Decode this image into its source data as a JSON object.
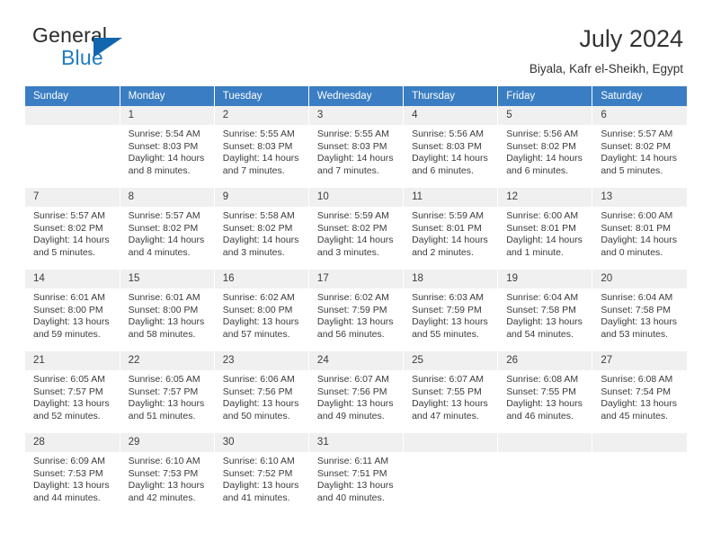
{
  "brand": {
    "line1": "General",
    "line2": "Blue",
    "triangle_color": "#1266ad",
    "blue_color": "#1f7cc4"
  },
  "header": {
    "title": "July 2024",
    "subtitle": "Biyala, Kafr el-Sheikh, Egypt"
  },
  "theme": {
    "header_bar": "#3a7dc2",
    "daynum_bg": "#f0f0f0",
    "text": "#3b3b3b"
  },
  "calendar": {
    "weekday_headers": [
      "Sunday",
      "Monday",
      "Tuesday",
      "Wednesday",
      "Thursday",
      "Friday",
      "Saturday"
    ],
    "weeks": [
      [
        {
          "day": "",
          "sunrise": "",
          "sunset": "",
          "daylight1": "",
          "daylight2": ""
        },
        {
          "day": "1",
          "sunrise": "Sunrise: 5:54 AM",
          "sunset": "Sunset: 8:03 PM",
          "daylight1": "Daylight: 14 hours",
          "daylight2": "and 8 minutes."
        },
        {
          "day": "2",
          "sunrise": "Sunrise: 5:55 AM",
          "sunset": "Sunset: 8:03 PM",
          "daylight1": "Daylight: 14 hours",
          "daylight2": "and 7 minutes."
        },
        {
          "day": "3",
          "sunrise": "Sunrise: 5:55 AM",
          "sunset": "Sunset: 8:03 PM",
          "daylight1": "Daylight: 14 hours",
          "daylight2": "and 7 minutes."
        },
        {
          "day": "4",
          "sunrise": "Sunrise: 5:56 AM",
          "sunset": "Sunset: 8:03 PM",
          "daylight1": "Daylight: 14 hours",
          "daylight2": "and 6 minutes."
        },
        {
          "day": "5",
          "sunrise": "Sunrise: 5:56 AM",
          "sunset": "Sunset: 8:02 PM",
          "daylight1": "Daylight: 14 hours",
          "daylight2": "and 6 minutes."
        },
        {
          "day": "6",
          "sunrise": "Sunrise: 5:57 AM",
          "sunset": "Sunset: 8:02 PM",
          "daylight1": "Daylight: 14 hours",
          "daylight2": "and 5 minutes."
        }
      ],
      [
        {
          "day": "7",
          "sunrise": "Sunrise: 5:57 AM",
          "sunset": "Sunset: 8:02 PM",
          "daylight1": "Daylight: 14 hours",
          "daylight2": "and 5 minutes."
        },
        {
          "day": "8",
          "sunrise": "Sunrise: 5:57 AM",
          "sunset": "Sunset: 8:02 PM",
          "daylight1": "Daylight: 14 hours",
          "daylight2": "and 4 minutes."
        },
        {
          "day": "9",
          "sunrise": "Sunrise: 5:58 AM",
          "sunset": "Sunset: 8:02 PM",
          "daylight1": "Daylight: 14 hours",
          "daylight2": "and 3 minutes."
        },
        {
          "day": "10",
          "sunrise": "Sunrise: 5:59 AM",
          "sunset": "Sunset: 8:02 PM",
          "daylight1": "Daylight: 14 hours",
          "daylight2": "and 3 minutes."
        },
        {
          "day": "11",
          "sunrise": "Sunrise: 5:59 AM",
          "sunset": "Sunset: 8:01 PM",
          "daylight1": "Daylight: 14 hours",
          "daylight2": "and 2 minutes."
        },
        {
          "day": "12",
          "sunrise": "Sunrise: 6:00 AM",
          "sunset": "Sunset: 8:01 PM",
          "daylight1": "Daylight: 14 hours",
          "daylight2": "and 1 minute."
        },
        {
          "day": "13",
          "sunrise": "Sunrise: 6:00 AM",
          "sunset": "Sunset: 8:01 PM",
          "daylight1": "Daylight: 14 hours",
          "daylight2": "and 0 minutes."
        }
      ],
      [
        {
          "day": "14",
          "sunrise": "Sunrise: 6:01 AM",
          "sunset": "Sunset: 8:00 PM",
          "daylight1": "Daylight: 13 hours",
          "daylight2": "and 59 minutes."
        },
        {
          "day": "15",
          "sunrise": "Sunrise: 6:01 AM",
          "sunset": "Sunset: 8:00 PM",
          "daylight1": "Daylight: 13 hours",
          "daylight2": "and 58 minutes."
        },
        {
          "day": "16",
          "sunrise": "Sunrise: 6:02 AM",
          "sunset": "Sunset: 8:00 PM",
          "daylight1": "Daylight: 13 hours",
          "daylight2": "and 57 minutes."
        },
        {
          "day": "17",
          "sunrise": "Sunrise: 6:02 AM",
          "sunset": "Sunset: 7:59 PM",
          "daylight1": "Daylight: 13 hours",
          "daylight2": "and 56 minutes."
        },
        {
          "day": "18",
          "sunrise": "Sunrise: 6:03 AM",
          "sunset": "Sunset: 7:59 PM",
          "daylight1": "Daylight: 13 hours",
          "daylight2": "and 55 minutes."
        },
        {
          "day": "19",
          "sunrise": "Sunrise: 6:04 AM",
          "sunset": "Sunset: 7:58 PM",
          "daylight1": "Daylight: 13 hours",
          "daylight2": "and 54 minutes."
        },
        {
          "day": "20",
          "sunrise": "Sunrise: 6:04 AM",
          "sunset": "Sunset: 7:58 PM",
          "daylight1": "Daylight: 13 hours",
          "daylight2": "and 53 minutes."
        }
      ],
      [
        {
          "day": "21",
          "sunrise": "Sunrise: 6:05 AM",
          "sunset": "Sunset: 7:57 PM",
          "daylight1": "Daylight: 13 hours",
          "daylight2": "and 52 minutes."
        },
        {
          "day": "22",
          "sunrise": "Sunrise: 6:05 AM",
          "sunset": "Sunset: 7:57 PM",
          "daylight1": "Daylight: 13 hours",
          "daylight2": "and 51 minutes."
        },
        {
          "day": "23",
          "sunrise": "Sunrise: 6:06 AM",
          "sunset": "Sunset: 7:56 PM",
          "daylight1": "Daylight: 13 hours",
          "daylight2": "and 50 minutes."
        },
        {
          "day": "24",
          "sunrise": "Sunrise: 6:07 AM",
          "sunset": "Sunset: 7:56 PM",
          "daylight1": "Daylight: 13 hours",
          "daylight2": "and 49 minutes."
        },
        {
          "day": "25",
          "sunrise": "Sunrise: 6:07 AM",
          "sunset": "Sunset: 7:55 PM",
          "daylight1": "Daylight: 13 hours",
          "daylight2": "and 47 minutes."
        },
        {
          "day": "26",
          "sunrise": "Sunrise: 6:08 AM",
          "sunset": "Sunset: 7:55 PM",
          "daylight1": "Daylight: 13 hours",
          "daylight2": "and 46 minutes."
        },
        {
          "day": "27",
          "sunrise": "Sunrise: 6:08 AM",
          "sunset": "Sunset: 7:54 PM",
          "daylight1": "Daylight: 13 hours",
          "daylight2": "and 45 minutes."
        }
      ],
      [
        {
          "day": "28",
          "sunrise": "Sunrise: 6:09 AM",
          "sunset": "Sunset: 7:53 PM",
          "daylight1": "Daylight: 13 hours",
          "daylight2": "and 44 minutes."
        },
        {
          "day": "29",
          "sunrise": "Sunrise: 6:10 AM",
          "sunset": "Sunset: 7:53 PM",
          "daylight1": "Daylight: 13 hours",
          "daylight2": "and 42 minutes."
        },
        {
          "day": "30",
          "sunrise": "Sunrise: 6:10 AM",
          "sunset": "Sunset: 7:52 PM",
          "daylight1": "Daylight: 13 hours",
          "daylight2": "and 41 minutes."
        },
        {
          "day": "31",
          "sunrise": "Sunrise: 6:11 AM",
          "sunset": "Sunset: 7:51 PM",
          "daylight1": "Daylight: 13 hours",
          "daylight2": "and 40 minutes."
        },
        {
          "day": "",
          "sunrise": "",
          "sunset": "",
          "daylight1": "",
          "daylight2": ""
        },
        {
          "day": "",
          "sunrise": "",
          "sunset": "",
          "daylight1": "",
          "daylight2": ""
        },
        {
          "day": "",
          "sunrise": "",
          "sunset": "",
          "daylight1": "",
          "daylight2": ""
        }
      ]
    ]
  }
}
